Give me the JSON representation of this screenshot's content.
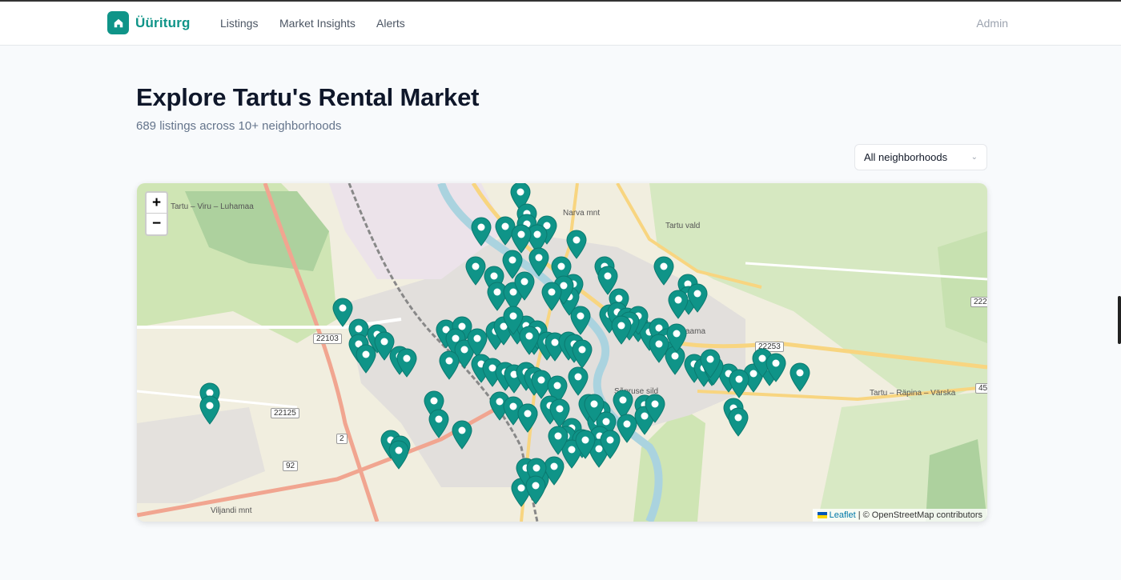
{
  "app": {
    "name": "Üüriturg",
    "nav": [
      "Listings",
      "Market Insights",
      "Alerts"
    ],
    "user": "Admin"
  },
  "page": {
    "title": "Explore Tartu's Rental Market",
    "subtitle": "689 listings across 10+ neighborhoods"
  },
  "filter": {
    "selected": "All neighborhoods"
  },
  "map": {
    "zoom_in": "+",
    "zoom_out": "−",
    "attribution_link": "Leaflet",
    "attribution_text": "| © OpenStreetMap contributors",
    "marker_color": "#0f9488",
    "road_labels": [
      "22103",
      "22125",
      "22253",
      "2",
      "92",
      "45",
      "222"
    ],
    "place_labels": [
      "Sõpruse sild",
      "Tartu – Räpina – Värska",
      "Viljandi mnt",
      "Jaama",
      "Tartu vald",
      "Narva mnt",
      "Tartu – Viru – Luhamaa"
    ]
  }
}
